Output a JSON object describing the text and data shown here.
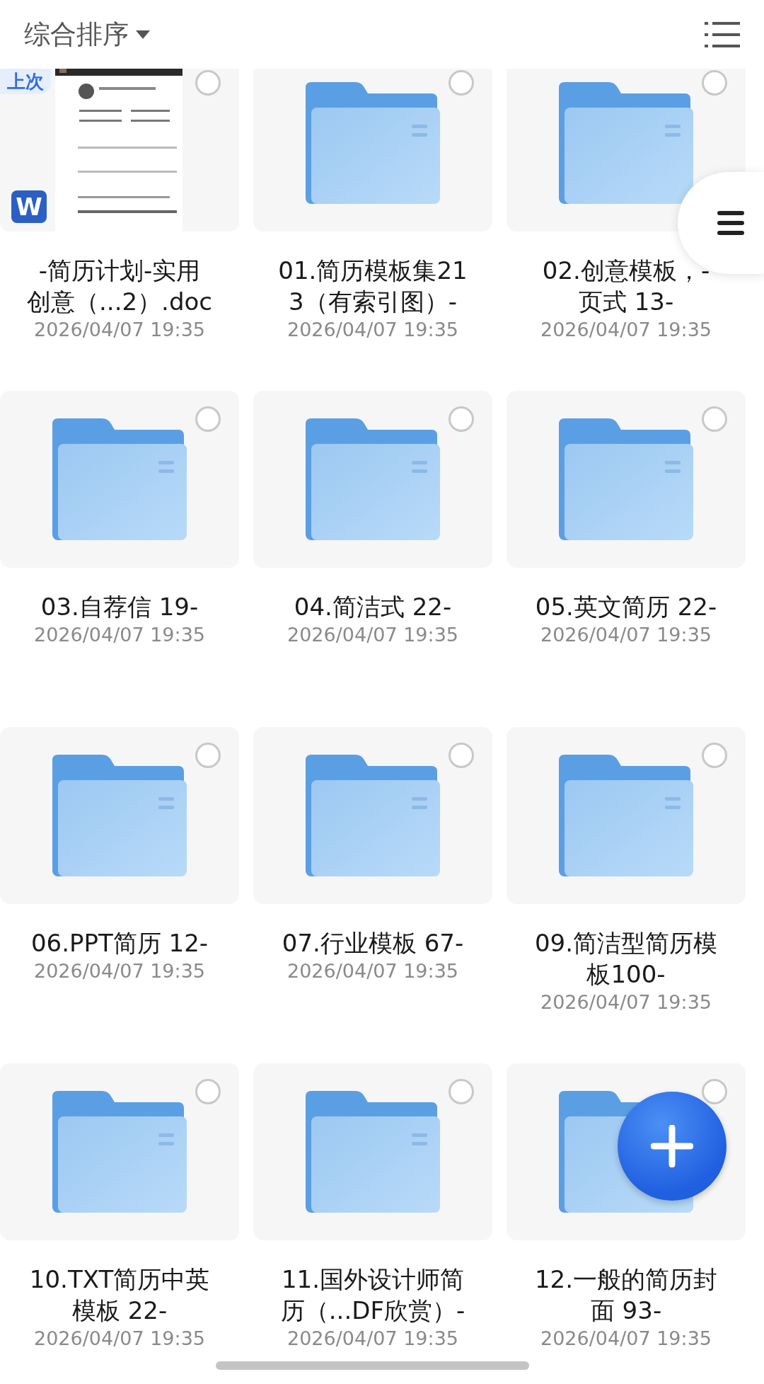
{
  "header": {
    "sort_label": "综合排序"
  },
  "items": [
    {
      "kind": "doc",
      "badge": "上次",
      "file_type": "W",
      "title_lines": [
        "-简历计划-实用",
        "创意（...2）.doc"
      ],
      "date": "2026/04/07 19:35",
      "selected": false
    },
    {
      "kind": "folder",
      "title_lines": [
        "01.简历模板集21",
        "3（有索引图）-"
      ],
      "date": "2026/04/07 19:35",
      "selected": false
    },
    {
      "kind": "folder",
      "title_lines": [
        "02.创意模板，-",
        "页式 13-"
      ],
      "date": "2026/04/07 19:35",
      "selected": false
    },
    {
      "kind": "folder",
      "title_lines": [
        "03.自荐信 19-"
      ],
      "date": "2026/04/07 19:35",
      "selected": false
    },
    {
      "kind": "folder",
      "title_lines": [
        "04.简洁式 22-"
      ],
      "date": "2026/04/07 19:35",
      "selected": false
    },
    {
      "kind": "folder",
      "title_lines": [
        "05.英文简历 22-"
      ],
      "date": "2026/04/07 19:35",
      "selected": false
    },
    {
      "kind": "folder",
      "title_lines": [
        "06.PPT简历 12-"
      ],
      "date": "2026/04/07 19:35",
      "selected": false
    },
    {
      "kind": "folder",
      "title_lines": [
        "07.行业模板 67-"
      ],
      "date": "2026/04/07 19:35",
      "selected": false
    },
    {
      "kind": "folder",
      "title_lines": [
        "09.简洁型简历模",
        "板100-"
      ],
      "date": "2026/04/07 19:35",
      "selected": false
    },
    {
      "kind": "folder",
      "title_lines": [
        "10.TXT简历中英",
        "模板 22-"
      ],
      "date": "2026/04/07 19:35",
      "selected": false
    },
    {
      "kind": "folder",
      "title_lines": [
        "11.国外设计师简",
        "历（...DF欣赏）-"
      ],
      "date": "2026/04/07 19:35",
      "selected": false
    },
    {
      "kind": "folder",
      "title_lines": [
        "12.一般的简历封",
        "面 93-"
      ],
      "date": "2026/04/07 19:35",
      "selected": false
    }
  ]
}
